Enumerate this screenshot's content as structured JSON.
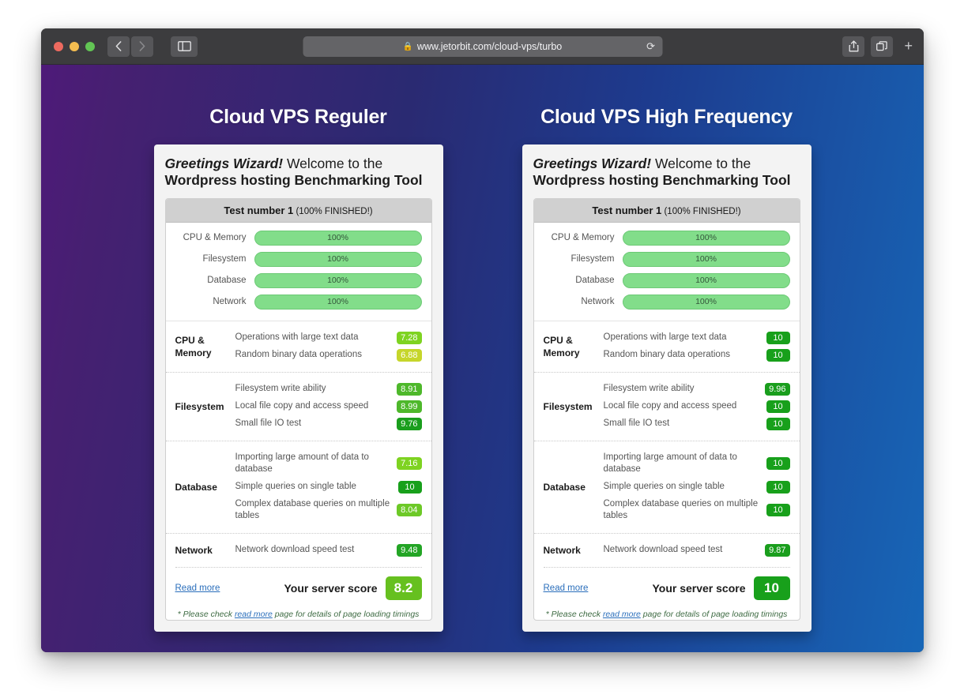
{
  "browser": {
    "url": "www.jetorbit.com/cloud-vps/turbo",
    "lock_icon": "lock-icon",
    "reload_icon": "reload-icon",
    "back_icon": "back-chevron-icon",
    "forward_icon": "forward-chevron-icon",
    "sidebar_icon": "sidebar-icon",
    "share_icon": "share-icon",
    "tabs_icon": "tab-overview-icon",
    "new_tab_icon": "plus-icon",
    "traffic_lights": [
      "close-button",
      "minimize-button",
      "zoom-button"
    ]
  },
  "page": {
    "background_from": "#4e1a79",
    "background_to": "#1766b7"
  },
  "columns": [
    {
      "title": "Cloud VPS Reguler",
      "card": {
        "greeting": "Greetings Wizard!",
        "welcome": " Welcome to the",
        "tool_line": "Wordpress hosting Benchmarking Tool",
        "panel_head": {
          "test": "Test number 1",
          "status": " (100% FINISHED!)"
        },
        "progress": [
          {
            "label": "CPU & Memory",
            "value": "100%"
          },
          {
            "label": "Filesystem",
            "value": "100%"
          },
          {
            "label": "Database",
            "value": "100%"
          },
          {
            "label": "Network",
            "value": "100%"
          }
        ],
        "groups": [
          {
            "name": "CPU & Memory",
            "rows": [
              {
                "text": "Operations with large text data",
                "score": "7.28",
                "color": "#7ed321"
              },
              {
                "text": "Random binary data operations",
                "score": "6.88",
                "color": "#c6d62b"
              }
            ]
          },
          {
            "name": "Filesystem",
            "rows": [
              {
                "text": "Filesystem write ability",
                "score": "8.91",
                "color": "#4eb82b"
              },
              {
                "text": "Local file copy and access speed",
                "score": "8.99",
                "color": "#4eb82b"
              },
              {
                "text": "Small file IO test",
                "score": "9.76",
                "color": "#1a9e1d"
              }
            ]
          },
          {
            "name": "Database",
            "rows": [
              {
                "text": "Importing large amount of data to database",
                "score": "7.16",
                "color": "#7ed321"
              },
              {
                "text": "Simple queries on single table",
                "score": "10",
                "color": "#18a01b"
              },
              {
                "text": "Complex database queries on multiple tables",
                "score": "8.04",
                "color": "#6dc927"
              }
            ]
          },
          {
            "name": "Network",
            "rows": [
              {
                "text": "Network download speed test",
                "score": "9.48",
                "color": "#23a525"
              }
            ]
          }
        ],
        "footer": {
          "read_more": "Read more",
          "server_score_label": "Your server score",
          "server_score": "8.2",
          "server_score_color": "#66c01f"
        },
        "note": {
          "prefix": "* Please check ",
          "link": "read more",
          "suffix": " page for details of page loading timings"
        }
      }
    },
    {
      "title": "Cloud VPS High Frequency",
      "card": {
        "greeting": "Greetings Wizard!",
        "welcome": " Welcome to the",
        "tool_line": "Wordpress hosting Benchmarking Tool",
        "panel_head": {
          "test": "Test number 1",
          "status": " (100% FINISHED!)"
        },
        "progress": [
          {
            "label": "CPU & Memory",
            "value": "100%"
          },
          {
            "label": "Filesystem",
            "value": "100%"
          },
          {
            "label": "Database",
            "value": "100%"
          },
          {
            "label": "Network",
            "value": "100%"
          }
        ],
        "groups": [
          {
            "name": "CPU & Memory",
            "rows": [
              {
                "text": "Operations with large text data",
                "score": "10",
                "color": "#18a01b"
              },
              {
                "text": "Random binary data operations",
                "score": "10",
                "color": "#18a01b"
              }
            ]
          },
          {
            "name": "Filesystem",
            "rows": [
              {
                "text": "Filesystem write ability",
                "score": "9.96",
                "color": "#1a9e1d"
              },
              {
                "text": "Local file copy and access speed",
                "score": "10",
                "color": "#18a01b"
              },
              {
                "text": "Small file IO test",
                "score": "10",
                "color": "#18a01b"
              }
            ]
          },
          {
            "name": "Database",
            "rows": [
              {
                "text": "Importing large amount of data to database",
                "score": "10",
                "color": "#18a01b"
              },
              {
                "text": "Simple queries on single table",
                "score": "10",
                "color": "#18a01b"
              },
              {
                "text": "Complex database queries on multiple tables",
                "score": "10",
                "color": "#18a01b"
              }
            ]
          },
          {
            "name": "Network",
            "rows": [
              {
                "text": "Network download speed test",
                "score": "9.87",
                "color": "#1a9e1d"
              }
            ]
          }
        ],
        "footer": {
          "read_more": "Read more",
          "server_score_label": "Your server score",
          "server_score": "10",
          "server_score_color": "#18a01b"
        },
        "note": {
          "prefix": "* Please check ",
          "link": "read more",
          "suffix": " page for details of page loading timings"
        }
      }
    }
  ]
}
